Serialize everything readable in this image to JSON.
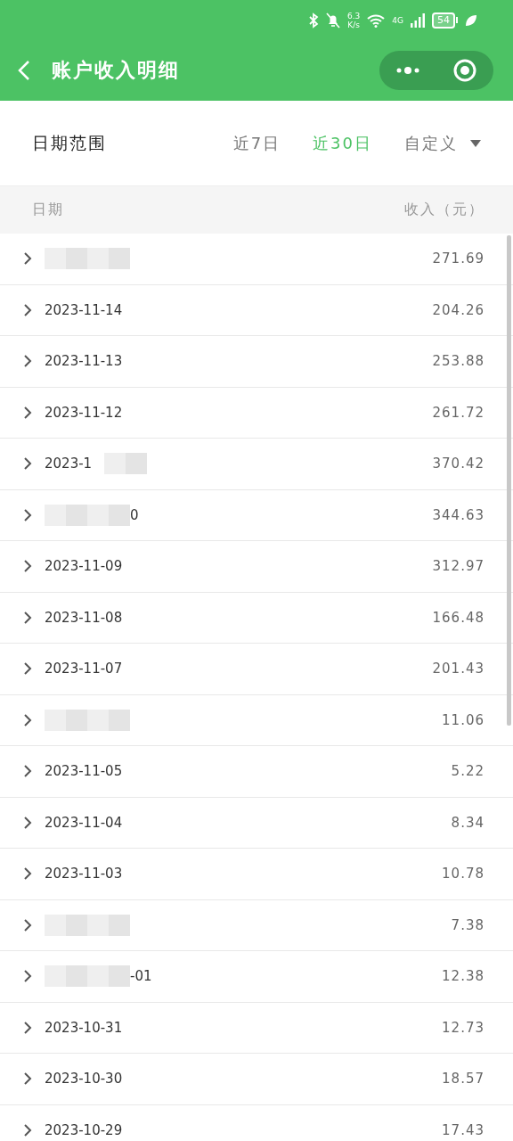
{
  "status_bar": {
    "speed": "6.3",
    "speed_unit": "K/s",
    "network": "4G",
    "battery": "54"
  },
  "nav": {
    "title": "账户收入明细"
  },
  "filter": {
    "label": "日期范围",
    "options": [
      {
        "label": "近7日",
        "selected": false
      },
      {
        "label": "近30日",
        "selected": true
      },
      {
        "label": "自定义",
        "selected": false
      }
    ]
  },
  "table": {
    "columns": [
      "日期",
      "收入（元）"
    ],
    "rows": [
      {
        "kind": "masked",
        "amount": "271.69"
      },
      {
        "kind": "plain",
        "date": "2023-11-14",
        "amount": "204.26"
      },
      {
        "kind": "plain",
        "date": "2023-11-13",
        "amount": "253.88"
      },
      {
        "kind": "plain",
        "date": "2023-11-12",
        "amount": "261.72"
      },
      {
        "kind": "maskedend",
        "date": "2023-1",
        "amount": "370.42"
      },
      {
        "kind": "maskedstart",
        "date": "0",
        "amount": "344.63"
      },
      {
        "kind": "plain",
        "date": "2023-11-09",
        "amount": "312.97"
      },
      {
        "kind": "plain",
        "date": "2023-11-08",
        "amount": "166.48"
      },
      {
        "kind": "plain",
        "date": "2023-11-07",
        "amount": "201.43"
      },
      {
        "kind": "masked",
        "amount": "11.06"
      },
      {
        "kind": "plain",
        "date": "2023-11-05",
        "amount": "5.22"
      },
      {
        "kind": "plain",
        "date": "2023-11-04",
        "amount": "8.34"
      },
      {
        "kind": "plain",
        "date": "2023-11-03",
        "amount": "10.78"
      },
      {
        "kind": "masked",
        "amount": "7.38"
      },
      {
        "kind": "maskedstart",
        "date": "-01",
        "amount": "12.38"
      },
      {
        "kind": "plain",
        "date": "2023-10-31",
        "amount": "12.73"
      },
      {
        "kind": "plain",
        "date": "2023-10-30",
        "amount": "18.57"
      },
      {
        "kind": "plain",
        "date": "2023-10-29",
        "amount": "17.43"
      }
    ]
  }
}
